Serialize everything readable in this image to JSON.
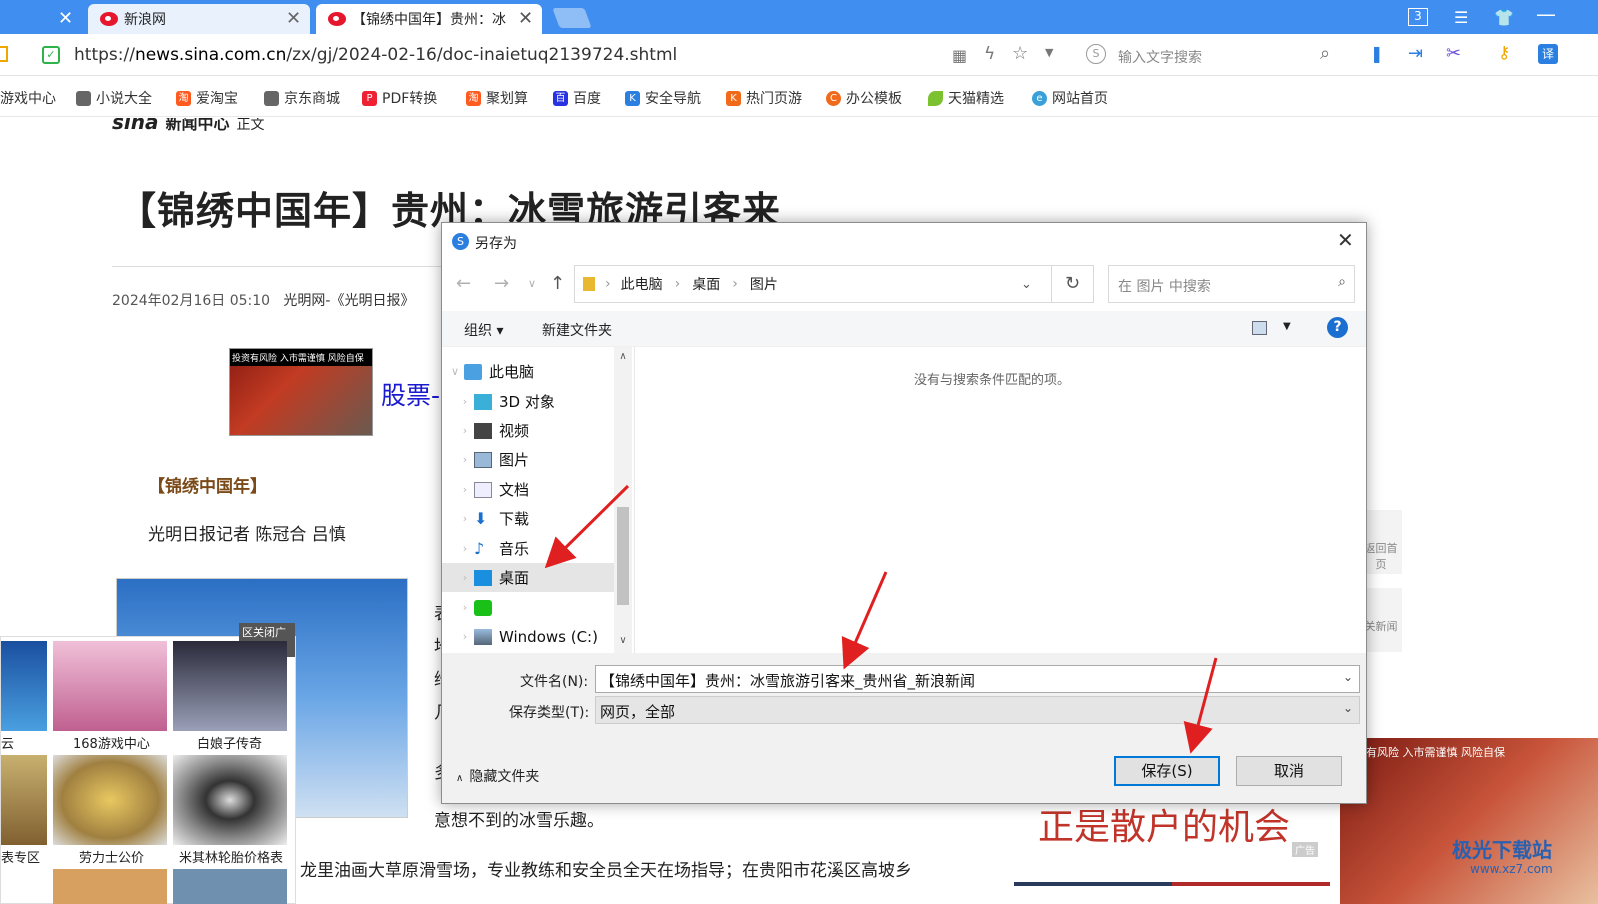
{
  "browser": {
    "tabs": [
      {
        "title": "新浪网"
      },
      {
        "title": "【锦绣中国年】贵州：冰"
      }
    ],
    "badge": "3",
    "url_prefix": "https://",
    "url_domain": "news.sina.com.cn",
    "url_path": "/zx/gj/2024-02-16/doc-inaietuq2139724.shtml",
    "search_placeholder": "输入文字搜索",
    "bookmarks": [
      "游戏中心",
      "小说大全",
      "爱淘宝",
      "京东商城",
      "PDF转换",
      "聚划算",
      "百度",
      "安全导航",
      "热门页游",
      "办公模板",
      "天猫精选",
      "网站首页"
    ]
  },
  "page": {
    "logo": "sina",
    "logo_cn": "新闻中心",
    "crumb": "正文",
    "title": "【锦绣中国年】贵州：冰雪旅游引客来",
    "date": "2024年02月16日 05:10",
    "source": "光明网-《光明日报》",
    "ad_text": "股票-",
    "ad_banner": "投资有风险 入市需谨慎 风险自保",
    "section": "【锦绣中国年】",
    "author": "光明日报记者 陈冠合 吕慎",
    "ad_close": "区关闭广告",
    "side_ads": [
      "168游戏中心",
      "白娘子传奇",
      "劳力士公价",
      "米其林轮胎价格表",
      "表专区",
      "云"
    ],
    "line1": "意想不到的冰雪乐趣。",
    "line2": "龙里油画大草原滑雪场，专业教练和安全员全天在场指导；在贵阳市花溪区高坡乡",
    "right_ad": "正是散户的机会",
    "right_ad_tag": "广告",
    "right_ad_banner": "有风险 入市需谨慎 风险自保",
    "right_nav": [
      "返回首页",
      "关新闻"
    ],
    "watermark": "极光下载站",
    "watermark_url": "www.xz7.com"
  },
  "dialog": {
    "title": "另存为",
    "crumbs": [
      "此电脑",
      "桌面",
      "图片"
    ],
    "search_placeholder": "在 图片 中搜索",
    "organize": "组织",
    "new_folder": "新建文件夹",
    "empty": "没有与搜索条件匹配的项。",
    "tree": [
      "此电脑",
      "3D 对象",
      "视频",
      "图片",
      "文档",
      "下载",
      "音乐",
      "桌面",
      "",
      "Windows (C:)"
    ],
    "filename_label": "文件名(N):",
    "filename": "【锦绣中国年】贵州：冰雪旅游引客来_贵州省_新浪新闻",
    "type_label": "保存类型(T):",
    "type": "网页，全部",
    "hide_folders": "隐藏文件夹",
    "save": "保存(S)",
    "cancel": "取消"
  }
}
